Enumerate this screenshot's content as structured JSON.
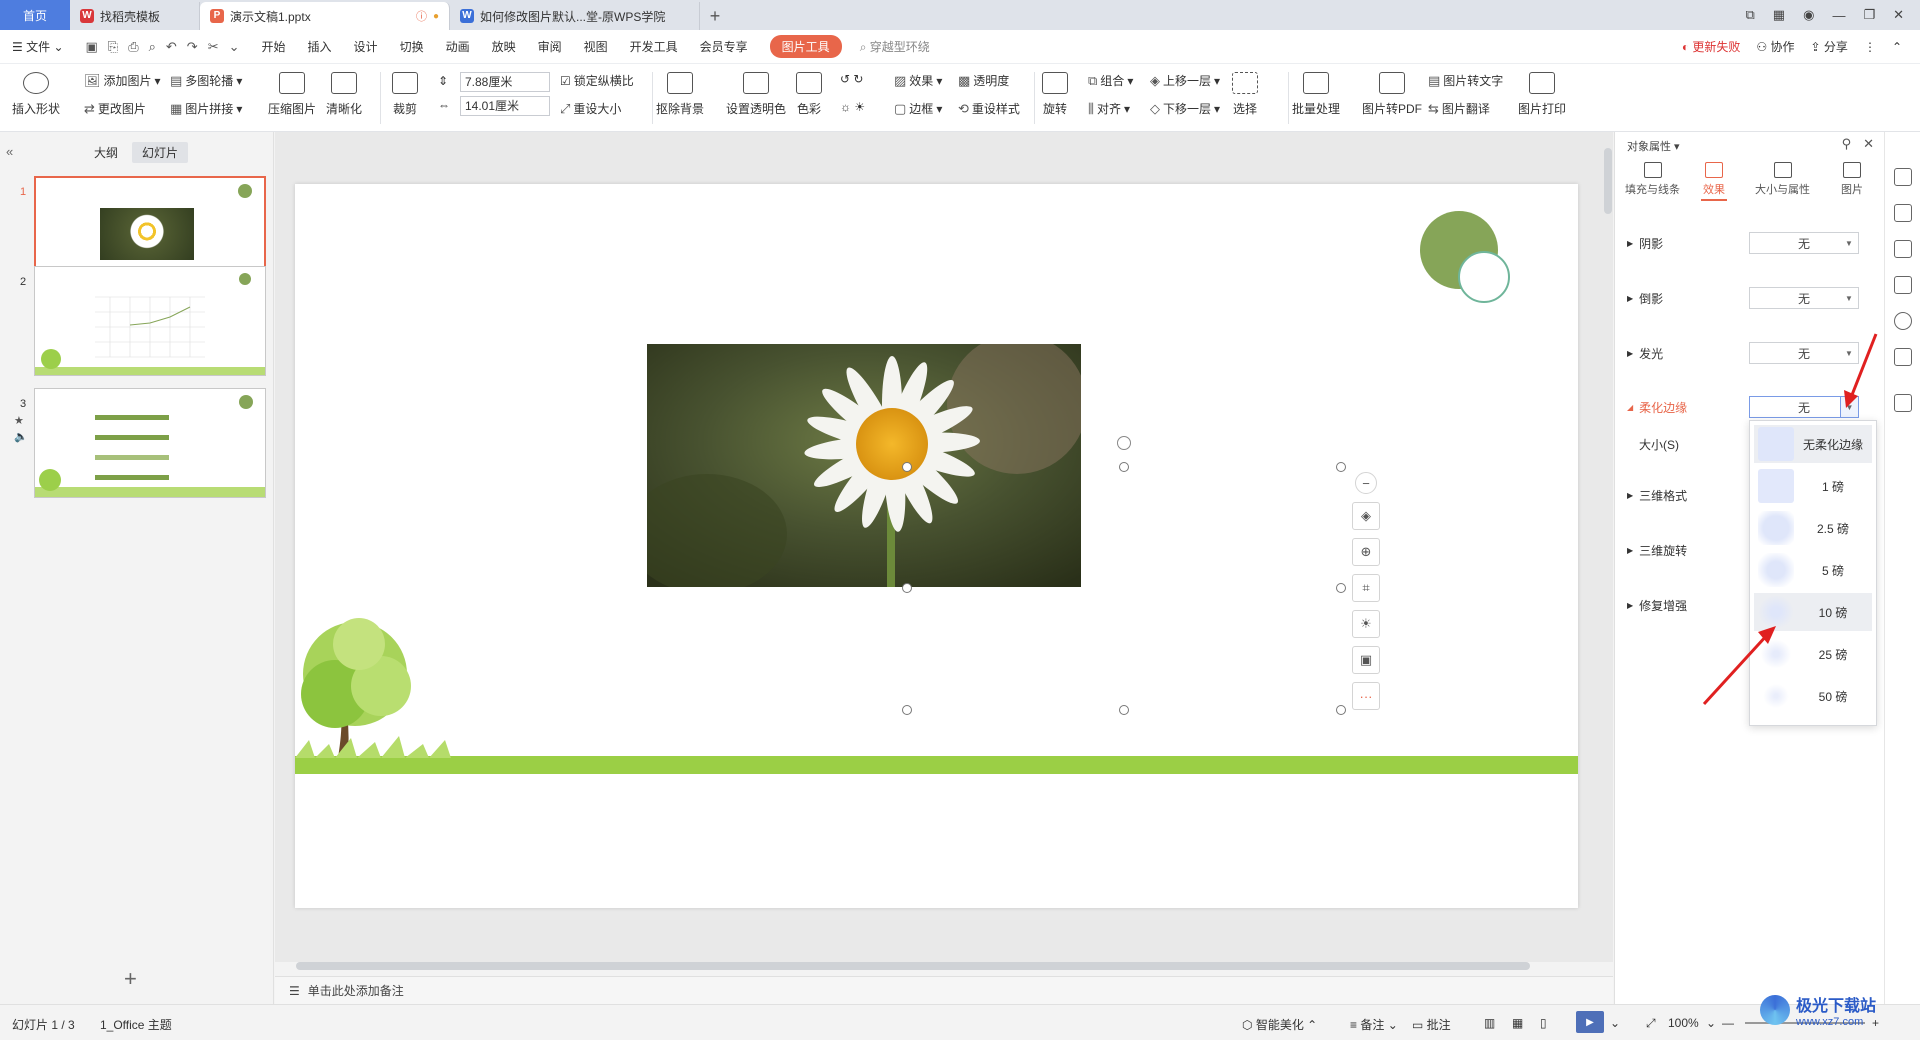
{
  "tabs": {
    "home": "首页",
    "items": [
      {
        "label": "找稻壳模板",
        "icon_color": "#d9373a"
      },
      {
        "label": "演示文稿1.pptx",
        "icon_color": "#e8664a"
      },
      {
        "label": "如何修改图片默认...堂-原WPS学院",
        "icon_color": "#3b6fd8"
      }
    ],
    "add": "+"
  },
  "menu": {
    "file": "文件",
    "items": [
      "开始",
      "插入",
      "设计",
      "切换",
      "动画",
      "放映",
      "审阅",
      "视图",
      "开发工具",
      "会员专享"
    ],
    "picture_tool": "图片工具",
    "search": "穿越型环绕",
    "right": {
      "update_fail": "更新失败",
      "collab": "协作",
      "share": "分享"
    }
  },
  "ribbon": {
    "insert_shape": "插入形状",
    "add_picture": "添加图片",
    "change_picture": "更改图片",
    "multi_outline": "多图轮播",
    "picture_collage": "图片拼接",
    "compress": "压缩图片",
    "sharpen": "清晰化",
    "crop": "裁剪",
    "width": "7.88厘米",
    "height": "14.01厘米",
    "lock_ratio": "锁定纵横比",
    "reset_size": "重设大小",
    "remove_bg": "抠除背景",
    "set_transparent": "设置透明色",
    "color": "色彩",
    "effects": "效果",
    "transparency": "透明度",
    "border": "边框",
    "reset_style": "重设样式",
    "rotate": "旋转",
    "group": "组合",
    "align": "对齐",
    "bring_forward": "上移一层",
    "send_backward": "下移一层",
    "select": "选择",
    "batch": "批量处理",
    "to_pdf": "图片转PDF",
    "to_text": "图片转文字",
    "translate": "图片翻译",
    "print": "图片打印"
  },
  "left_panel": {
    "tab_outline": "大纲",
    "tab_slides": "幻灯片",
    "slide_numbers": [
      "1",
      "2",
      "3"
    ],
    "add": "+"
  },
  "notes": {
    "placeholder": "单击此处添加备注"
  },
  "right_panel": {
    "title": "对象属性",
    "tabs": [
      "填充与线条",
      "效果",
      "大小与属性",
      "图片"
    ],
    "active_tab": "效果",
    "props": [
      {
        "label": "阴影",
        "value": "无"
      },
      {
        "label": "倒影",
        "value": "无"
      },
      {
        "label": "发光",
        "value": "无"
      },
      {
        "label": "柔化边缘",
        "value": "无"
      }
    ],
    "size_label": "大小(S)",
    "more_props": [
      "三维格式",
      "三维旋转",
      "修复增强"
    ],
    "dropdown_items": [
      "无柔化边缘",
      "1 磅",
      "2.5 磅",
      "5 磅",
      "10 磅",
      "25 磅",
      "50 磅"
    ]
  },
  "status": {
    "slide_info": "幻灯片 1 / 3",
    "theme": "1_Office 主题",
    "smart": "智能美化",
    "notes": "备注",
    "comments": "批注",
    "zoom": "100%"
  },
  "watermark": {
    "name": "极光下载站",
    "url": "www.xz7.com"
  },
  "colors": {
    "accent": "#e8664a",
    "home_tab": "#4e7ddf",
    "circle_green": "#86a558",
    "circle_outline": "#6fb59a"
  }
}
